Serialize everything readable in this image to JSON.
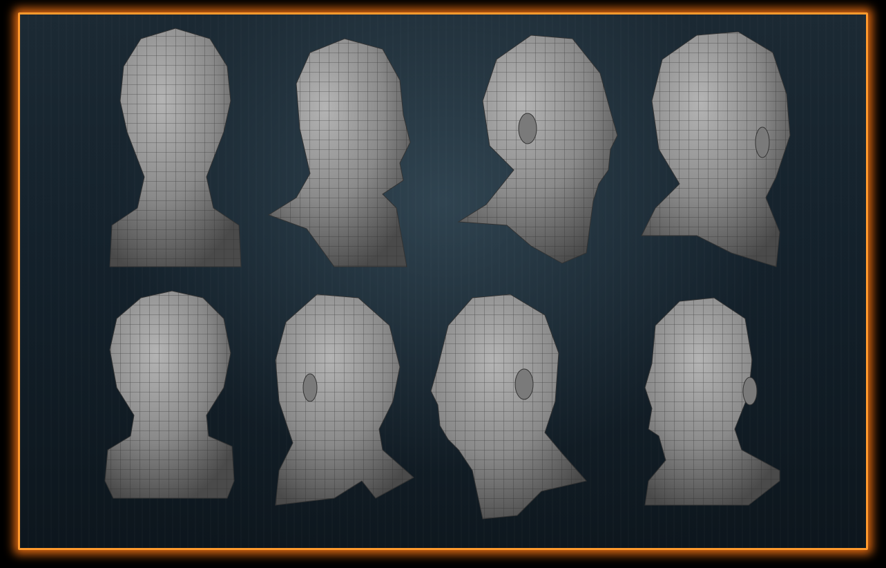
{
  "image": {
    "subject": "3d-head-wireframe-turnaround",
    "frame_color": "#ff9a2e",
    "background_color": "#16232d",
    "mesh_color": "#8c8c8c",
    "wire_color": "#2c2c2c"
  },
  "heads": [
    {
      "view": "front"
    },
    {
      "view": "three-quarter-right"
    },
    {
      "view": "profile-right"
    },
    {
      "view": "back-three-quarter-right"
    },
    {
      "view": "back"
    },
    {
      "view": "back-three-quarter-left"
    },
    {
      "view": "profile-left"
    },
    {
      "view": "three-quarter-left"
    }
  ]
}
